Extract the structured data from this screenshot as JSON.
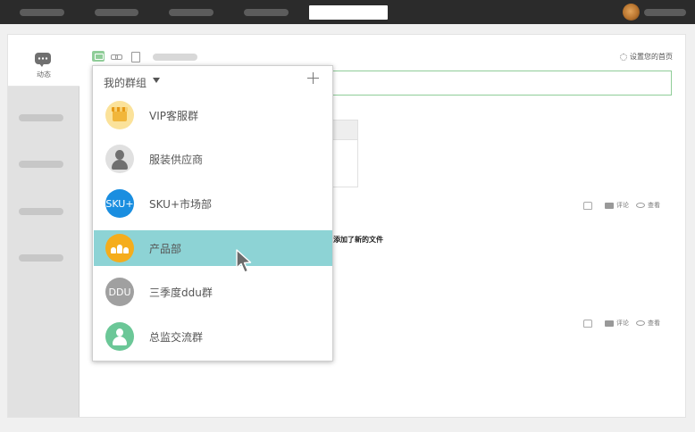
{
  "sidebar": {
    "active_label": "动态"
  },
  "toolbar": {
    "settings_label": "设置您的首页"
  },
  "feed": {
    "activity_text": "添加了新的文件",
    "actions": {
      "comment_label": "评论",
      "view_label": "查看"
    }
  },
  "dropdown": {
    "title": "我的群组",
    "items": [
      {
        "label": "VIP客服群",
        "avatar": "store-icon",
        "avatar_text": "",
        "color": "#fbe29a"
      },
      {
        "label": "服装供应商",
        "avatar": "person-icon",
        "avatar_text": "",
        "color": "#e0e0e0"
      },
      {
        "label": "SKU+市场部",
        "avatar": "text",
        "avatar_text": "SKU+",
        "color": "#1a8ee0"
      },
      {
        "label": "产品部",
        "avatar": "group-icon",
        "avatar_text": "",
        "color": "#f5ad1c"
      },
      {
        "label": "三季度ddu群",
        "avatar": "text",
        "avatar_text": "DDU",
        "color": "#a0a0a0"
      },
      {
        "label": "总监交流群",
        "avatar": "person-icon",
        "avatar_text": "",
        "color": "#6bc797"
      }
    ],
    "active_index": 3
  },
  "colors": {
    "accent_green": "#8fcd98",
    "active_row": "#8dd3d5",
    "topbar": "#2b2b2b"
  }
}
